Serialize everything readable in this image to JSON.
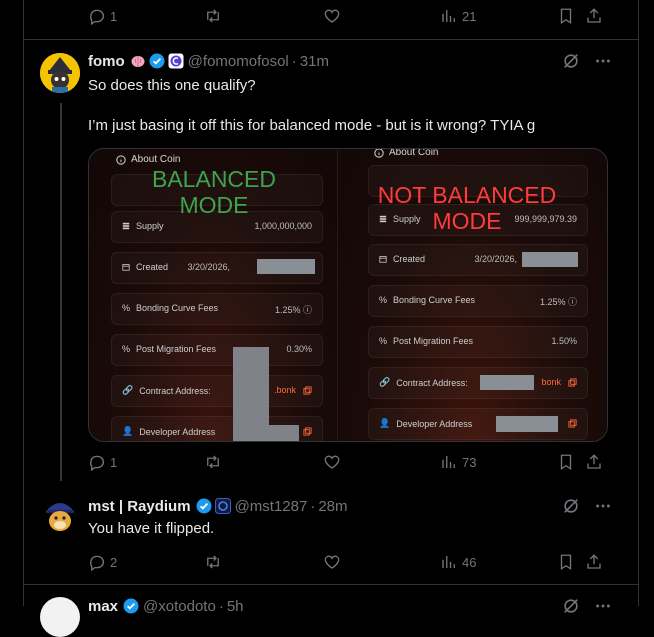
{
  "top_tweet_actions": {
    "replies": "1",
    "views": "21"
  },
  "tweet1": {
    "name": "fomo",
    "handle": "@fomomofosol",
    "time": "31m",
    "line1": "So does this one qualify?",
    "line2": "I’m just basing it off this for balanced mode - but is it wrong? TYIA g",
    "media": {
      "left": {
        "title": "About Coin",
        "overlay_line1": "BALANCED",
        "overlay_line2": "MODE",
        "rows": [
          {
            "label": "Supply",
            "value": "1,000,000,000"
          },
          {
            "label": "Created",
            "value": "3/20/2026,"
          },
          {
            "label": "Bonding Curve Fees",
            "value": "1.25% ⓘ"
          },
          {
            "label": "Post Migration Fees",
            "value": "0.30%"
          },
          {
            "label": "Contract Address:",
            "value": ".bonk"
          },
          {
            "label": "Developer Address",
            "value": ""
          }
        ]
      },
      "right": {
        "title": "About Coin",
        "overlay_line1": "NOT BALANCED",
        "overlay_line2": "MODE",
        "rows": [
          {
            "label": "Supply",
            "value": "999,999,979.39"
          },
          {
            "label": "Created",
            "value": "3/20/2026,"
          },
          {
            "label": "Bonding Curve Fees",
            "value": "1.25% ⓘ"
          },
          {
            "label": "Post Migration Fees",
            "value": "1.50%"
          },
          {
            "label": "Contract Address:",
            "value": "bonk"
          },
          {
            "label": "Developer Address",
            "value": ""
          }
        ]
      }
    },
    "actions": {
      "replies": "1",
      "views": "73"
    }
  },
  "tweet2": {
    "name": "mst | Raydium",
    "handle": "@mst1287",
    "time": "28m",
    "text": "You have it flipped.",
    "actions": {
      "replies": "2",
      "views": "46"
    }
  },
  "tweet3_partial": {
    "name": "max",
    "handle": "@xotodoto",
    "time": "5h"
  },
  "colors": {
    "background": "#000000",
    "verified": "#1d9bf0",
    "muted": "#71767b",
    "border": "#2f3336"
  }
}
